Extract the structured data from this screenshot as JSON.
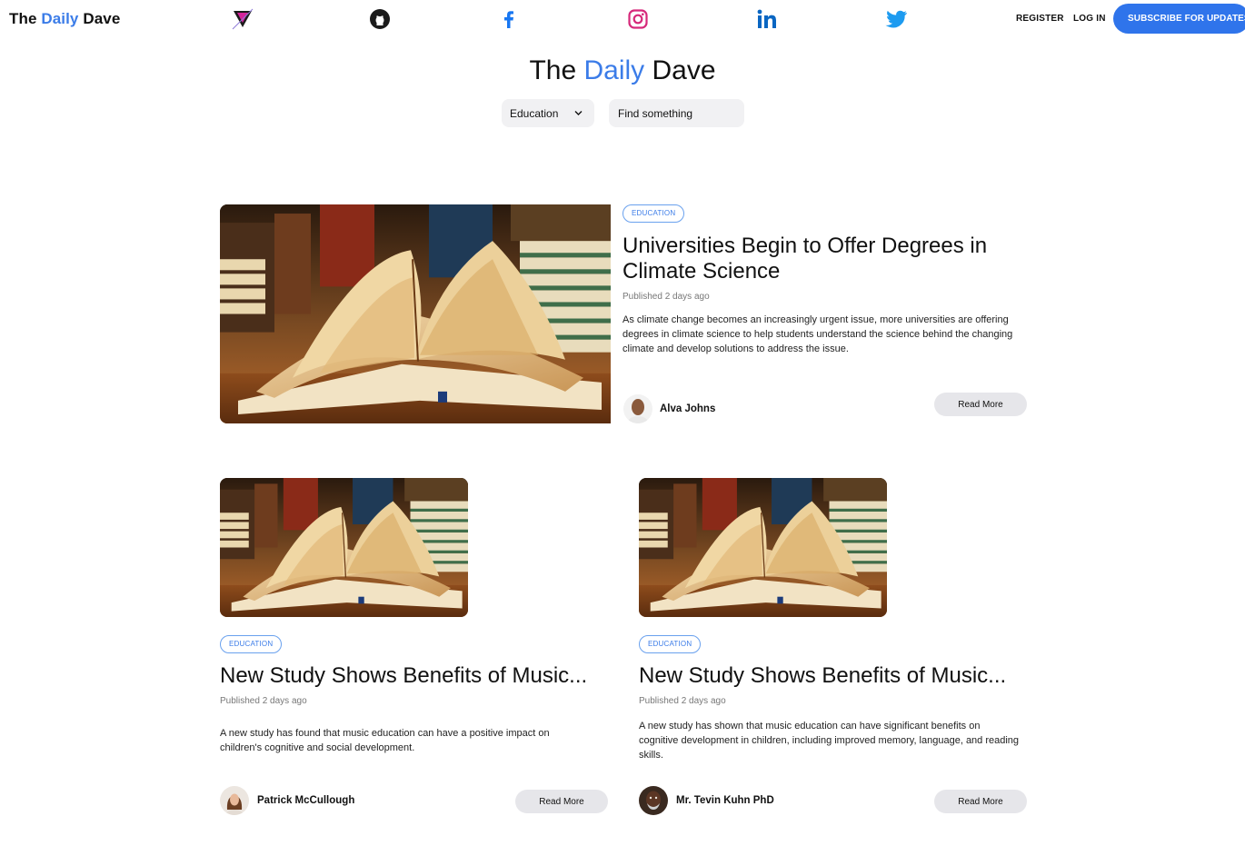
{
  "brand": {
    "part1": "The",
    "part2": "Daily",
    "part3": "Dave"
  },
  "nav": {
    "social": [
      {
        "icon": "triangle-logo-icon"
      },
      {
        "icon": "github-icon"
      },
      {
        "icon": "facebook-icon"
      },
      {
        "icon": "instagram-icon"
      },
      {
        "icon": "linkedin-icon"
      },
      {
        "icon": "twitter-icon"
      }
    ],
    "register": "REGISTER",
    "login": "LOG IN",
    "subscribe": "SUBSCRIBE FOR UPDATES"
  },
  "hero": {
    "title_part1": "The",
    "title_part2": "Daily",
    "title_part3": "Dave",
    "category_selected": "Education",
    "search_placeholder": "Find something"
  },
  "colors": {
    "accent": "#2f74eb",
    "brand_blue": "#3b7ce8",
    "tag_border": "#6aa1ee"
  },
  "featured": {
    "tag": "EDUCATION",
    "title": "Universities Begin to Offer Degrees in Climate Science",
    "published": "Published 2 days ago",
    "excerpt": "As climate change becomes an increasingly urgent issue, more universities are offering degrees in climate science to help students understand the science behind the changing climate and develop solutions to address the issue.",
    "author": "Alva Johns",
    "read_more": "Read More"
  },
  "articles": [
    {
      "tag": "EDUCATION",
      "title": "New Study Shows Benefits of Music...",
      "published": "Published 2 days ago",
      "excerpt": "A new study has found that music education can have a positive impact on children's cognitive and social development.",
      "author": "Patrick McCullough",
      "read_more": "Read More"
    },
    {
      "tag": "EDUCATION",
      "title": "New Study Shows Benefits of Music...",
      "published": "Published 2 days ago",
      "excerpt": "A new study has shown that music education can have significant benefits on cognitive development in children, including improved memory, language, and reading skills.",
      "author": "Mr. Tevin Kuhn PhD",
      "read_more": "Read More"
    }
  ]
}
